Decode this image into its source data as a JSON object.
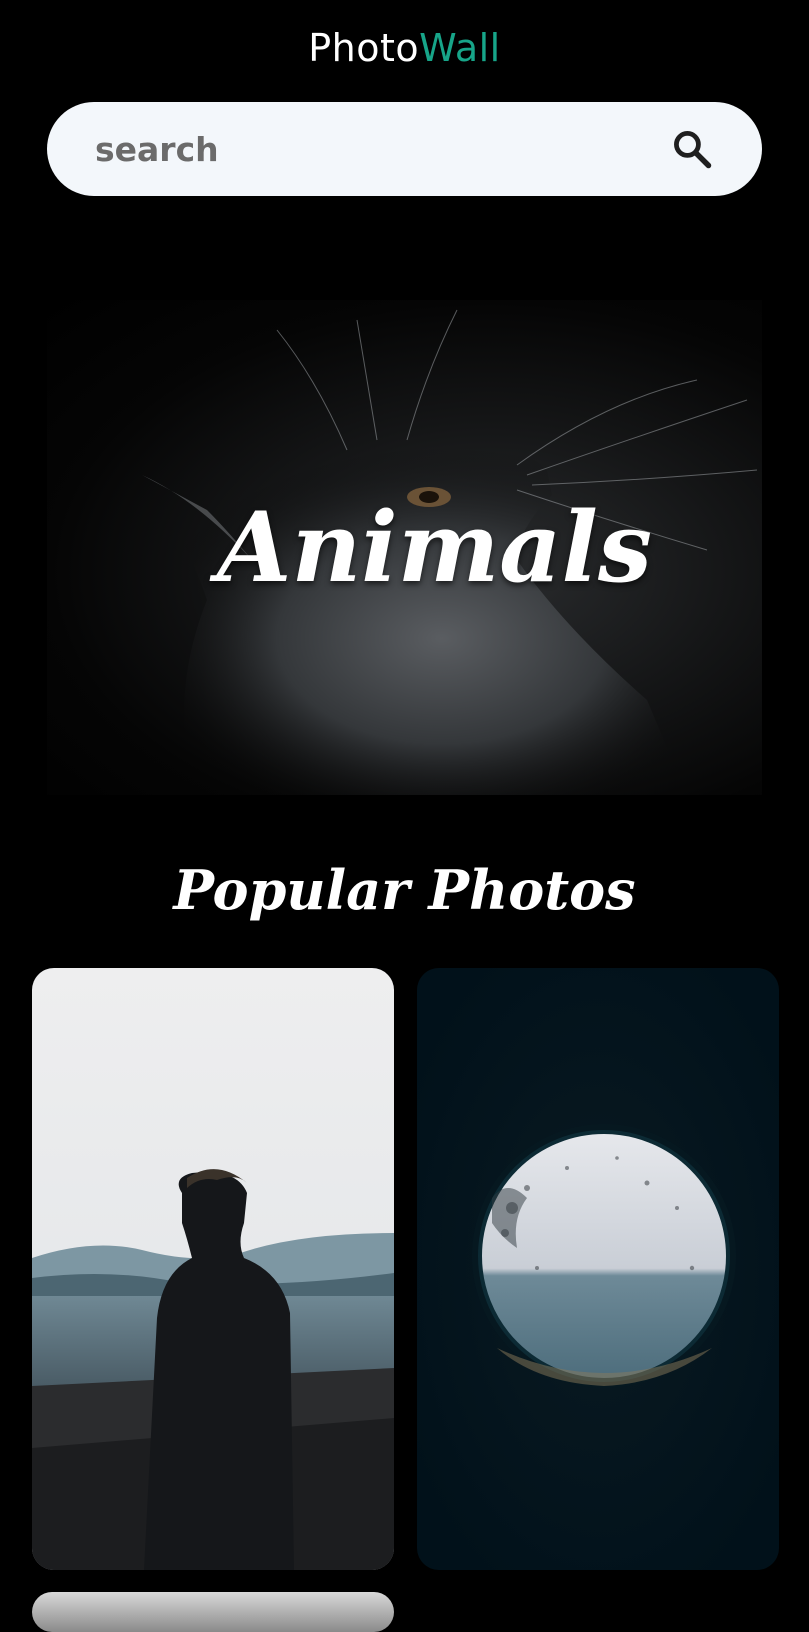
{
  "app": {
    "title_part_a": "Photo",
    "title_part_b": "Wall"
  },
  "search": {
    "placeholder": "search",
    "value": ""
  },
  "hero": {
    "label": "Animals"
  },
  "popular": {
    "heading": "Popular Photos"
  },
  "colors": {
    "background": "#000000",
    "accent": "#17a589",
    "search_bg": "#f3f7fb"
  },
  "icons": {
    "search": "search-icon"
  }
}
